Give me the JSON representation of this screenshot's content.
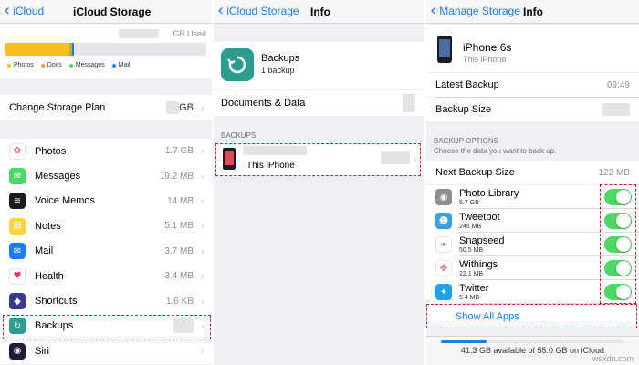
{
  "panel1": {
    "back_label": "iCloud",
    "title": "iCloud Storage",
    "gb_used": "GB Used",
    "legend": [
      "Photos",
      "Docs",
      "Messages",
      "Mail"
    ],
    "legend_colors": [
      "#f6c01c",
      "#f39a1e",
      "#4cd964",
      "#1a7cf5"
    ],
    "change_plan": "Change Storage Plan",
    "change_plan_value": "GB",
    "items": [
      {
        "label": "Photos",
        "value": "1.7 GB",
        "icon": "photos-icon",
        "color": "#ffffff"
      },
      {
        "label": "Messages",
        "value": "19.2 MB",
        "icon": "messages-icon",
        "color": "#4cd964"
      },
      {
        "label": "Voice Memos",
        "value": "14 MB",
        "icon": "voice-memos-icon",
        "color": "#1c1c1e"
      },
      {
        "label": "Notes",
        "value": "5.1 MB",
        "icon": "notes-icon",
        "color": "#fbd33d"
      },
      {
        "label": "Mail",
        "value": "3.7 MB",
        "icon": "mail-icon",
        "color": "#1a7cf5"
      },
      {
        "label": "Health",
        "value": "3.4 MB",
        "icon": "health-icon",
        "color": "#ffffff"
      },
      {
        "label": "Shortcuts",
        "value": "1.6 KB",
        "icon": "shortcuts-icon",
        "color": "#3b3b8c"
      },
      {
        "label": "Backups",
        "value": "",
        "icon": "backups-icon",
        "color": "#2a9d8f"
      },
      {
        "label": "Siri",
        "value": "",
        "icon": "siri-icon",
        "color": "#1c1c3c"
      }
    ]
  },
  "panel2": {
    "back_label": "iCloud Storage",
    "title": "Info",
    "backups_title": "Backups",
    "backups_count": "1 backup",
    "documents_data": "Documents & Data",
    "section_header": "BACKUPS",
    "device_label": "This iPhone"
  },
  "panel3": {
    "back_label": "Manage Storage",
    "title": "Info",
    "device_name": "iPhone 6s",
    "device_sub": "This iPhone",
    "latest_backup_label": "Latest Backup",
    "latest_backup_value": "09:49",
    "backup_size_label": "Backup Size",
    "section_header": "BACKUP OPTIONS",
    "section_sub": "Choose the data you want to back up.",
    "next_backup_label": "Next Backup Size",
    "next_backup_value": "122 MB",
    "apps": [
      {
        "name": "Photo Library",
        "size": "5.7 GB",
        "icon": "camera-icon",
        "color": "#8e8e93"
      },
      {
        "name": "Tweetbot",
        "size": "245 MB",
        "icon": "tweetbot-icon",
        "color": "#3aa0e8"
      },
      {
        "name": "Snapseed",
        "size": "50.5 MB",
        "icon": "snapseed-icon",
        "color": "#ffffff"
      },
      {
        "name": "Withings",
        "size": "22.1 MB",
        "icon": "withings-icon",
        "color": "#ffffff"
      },
      {
        "name": "Twitter",
        "size": "5.4 MB",
        "icon": "twitter-icon",
        "color": "#1da1f2"
      }
    ],
    "show_all": "Show All Apps",
    "footer": "41.3 GB available of 55.0 GB on iCloud"
  },
  "watermark": "wsxdn.com"
}
